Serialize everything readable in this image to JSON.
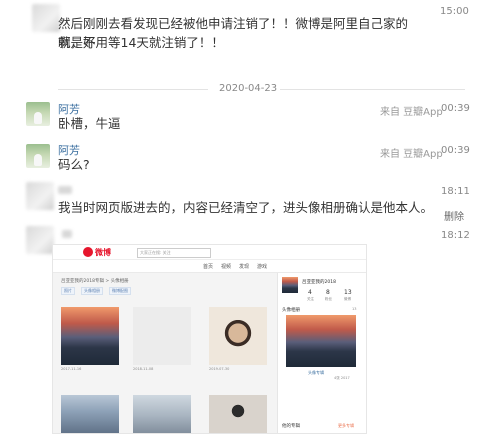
{
  "messages": {
    "msg1": {
      "text_line1": "然后刚刚去看发现已经被他申请注销了！！微博是阿里自己家的就是好",
      "text_line2": "啊，不用等14天就注销了！！",
      "time": "15:00"
    },
    "date_divider": "2020-04-23",
    "msg2": {
      "name": "阿芳",
      "text": "卧槽，牛逼",
      "source": "来自 豆瓣App",
      "time": "00:39"
    },
    "msg3": {
      "name": "阿芳",
      "text": "码么?",
      "source": "来自 豆瓣App",
      "time": "00:39"
    },
    "msg4": {
      "text": "我当时网页版进去的，内容已经清空了，进头像相册确认是他本人。",
      "time": "18:11",
      "delete": "删除"
    },
    "msg5": {
      "time": "18:12"
    }
  },
  "embedded_screenshot": {
    "brand": "微博",
    "search_placeholder": "大家正在搜: 关注",
    "nav": [
      "首页",
      "视频",
      "发现",
      "游戏"
    ],
    "breadcrumb": "吕亚亚我的2018专辑 > 头像相册",
    "tabs": [
      "照片",
      "头像相册",
      "微博配图"
    ],
    "captions": [
      "2017-11-16",
      "2018-11-08",
      "2019-07-30"
    ],
    "side": {
      "user": "吕亚亚我的2018",
      "stats": [
        {
          "num": "4",
          "label": "关注"
        },
        {
          "num": "8",
          "label": "粉丝"
        },
        {
          "num": "13",
          "label": "微博"
        }
      ],
      "album_title": "头像相册",
      "album_count": "13",
      "album_link": "头像专辑",
      "album_meta": "4张 2017",
      "bottom_link": "他的专辑",
      "bottom_more": "更多专辑"
    }
  }
}
